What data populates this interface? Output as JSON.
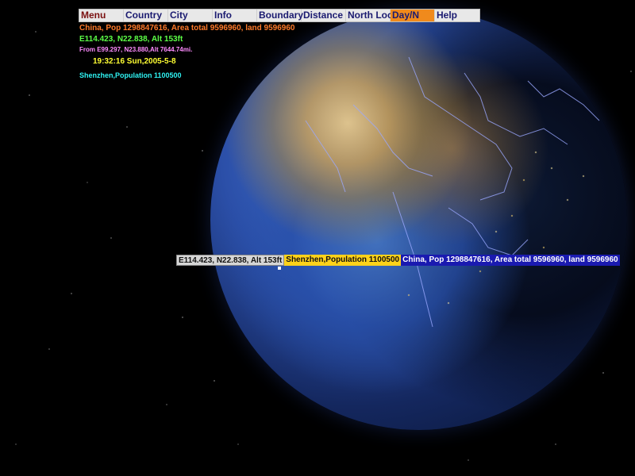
{
  "menu": {
    "items": [
      {
        "label": "Menu"
      },
      {
        "label": "Country"
      },
      {
        "label": "City"
      },
      {
        "label": "Info"
      },
      {
        "label": "Boundary"
      },
      {
        "label": "Distance"
      },
      {
        "label": "North Lock"
      },
      {
        "label": "Day/N"
      },
      {
        "label": "Help"
      }
    ],
    "active_label": "Day/N"
  },
  "info": {
    "country_line": "China, Pop  1298847616, Area total 9596960, land 9596960",
    "coords_line": "E114.423, N22.838, Alt 153ft",
    "from_line": "From E99.297, N23.880,Alt 7644.74mi.",
    "time_line": "19:32:16 Sun,2005-5-8",
    "city_line": "Shenzhen,Population  1100500"
  },
  "tooltip": {
    "coords": "E114.423, N22.838, Alt 153ft",
    "city": "Shenzhen,Population  1100500",
    "country": "China, Pop  1298847616, Area total 9596960, land 9596960"
  },
  "colors": {
    "active_menu": "#f08a1c",
    "tooltip_city_bg": "#ffd21a",
    "tooltip_country_bg": "#1a1ab0"
  }
}
